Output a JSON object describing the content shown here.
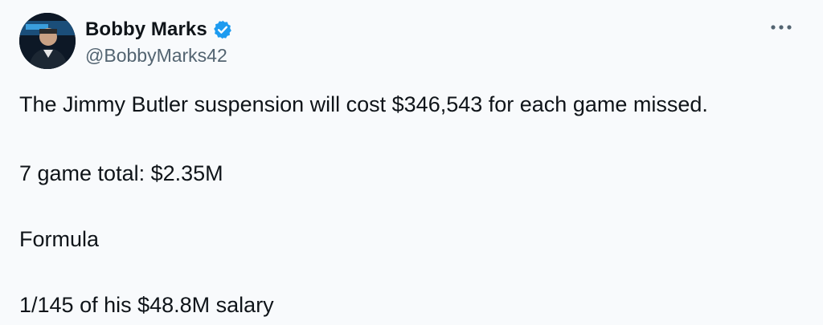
{
  "author": {
    "display_name": "Bobby Marks",
    "handle": "@BobbyMarks42",
    "verified": true,
    "avatar_icon": "profile-photo",
    "verified_icon": "verified-badge-icon",
    "verified_color": "#1d9bf0"
  },
  "menu": {
    "more_icon": "more-horizontal-icon"
  },
  "tweet": {
    "lines": [
      "The Jimmy Butler suspension will cost $346,543 for each game missed.",
      "7 game total: $2.35M",
      "Formula",
      "1/145 of his $48.8M salary"
    ]
  }
}
